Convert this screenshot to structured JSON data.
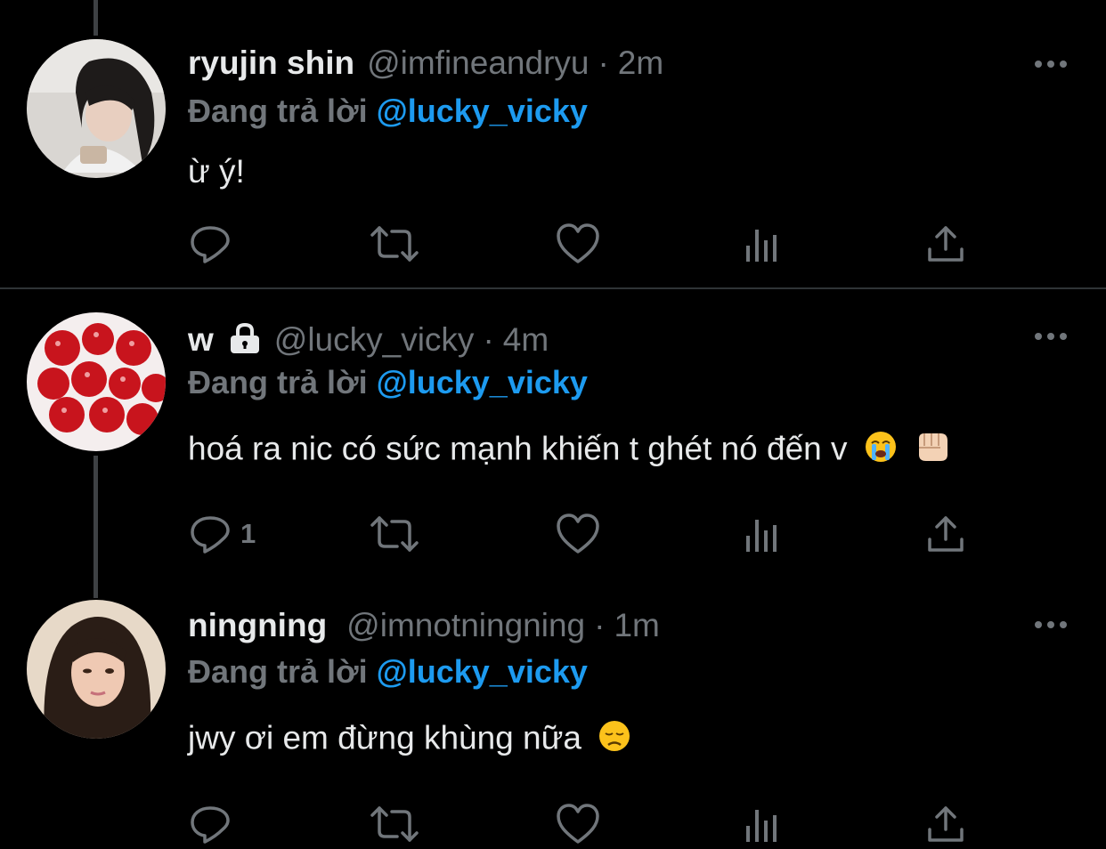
{
  "reply_prefix": "Đang trả lời",
  "tweets": [
    {
      "name": "ryujin shin",
      "handle": "@imfineandryu",
      "separator": "·",
      "time": "2m",
      "reply_to": "@lucky_vicky",
      "text": "ừ ý!",
      "reply_count": "",
      "avatar": "girl-portrait-light"
    },
    {
      "name": "w",
      "protected": true,
      "handle": "@lucky_vicky",
      "separator": "·",
      "time": "4m",
      "reply_to": "@lucky_vicky",
      "text": "hoá ra nic có sức mạnh khiến t ghét nó đến v",
      "emojis": [
        "loudly-crying-face",
        "oncoming-fist"
      ],
      "reply_count": "1",
      "avatar": "strawberries"
    },
    {
      "name": "ningning",
      "handle": "@imnotningning",
      "separator": "·",
      "time": "1m",
      "reply_to": "@lucky_vicky",
      "text": "jwy ơi em đừng khùng nữa",
      "emojis": [
        "disappointed-face"
      ],
      "reply_count": "",
      "avatar": "girl-portrait-warm"
    }
  ],
  "colors": {
    "background": "#000000",
    "text": "#e7e9ea",
    "muted": "#71767b",
    "accent": "#1d9bf0",
    "divider": "#2f3336"
  }
}
